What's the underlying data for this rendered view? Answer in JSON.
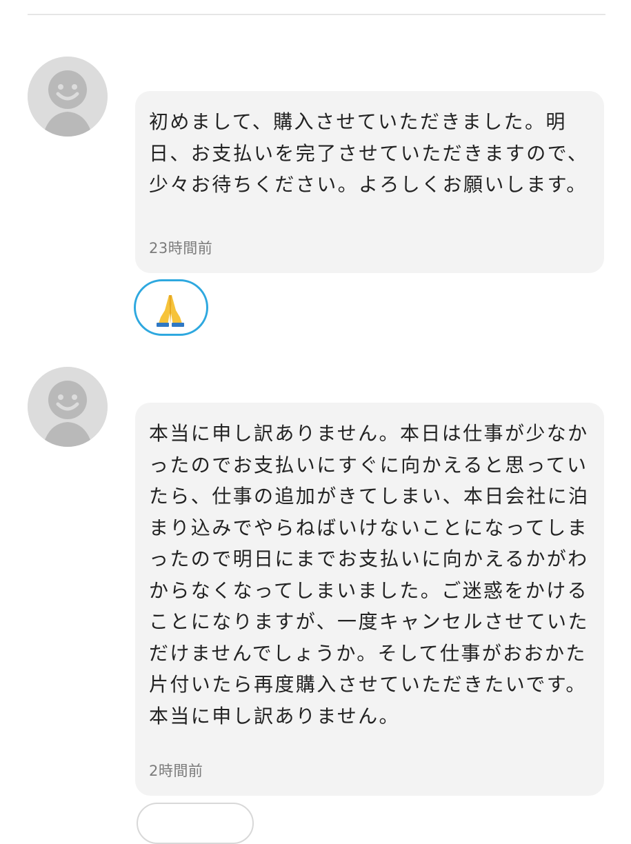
{
  "messages": [
    {
      "text": "初めまして、購入させていただきました。明日、お支払いを完了させていただきますので、少々お待ちください。よろしくお願いします。",
      "timestamp": "23時間前",
      "reaction_icon": "folded-hands-icon"
    },
    {
      "text": "本当に申し訳ありません。本日は仕事が少なかったのでお支払いにすぐに向かえると思っていたら、仕事の追加がきてしまい、本日会社に泊まり込みでやらねばいけないことになってしまったので明日にまでお支払いに向かえるかがわからなくなってしまいました。ご迷惑をかけることになりますが、一度キャンセルさせていただけませんでしょうか。そして仕事がおおかた片付いたら再度購入させていただきたいです。本当に申し訳ありません。",
      "timestamp": "2時間前"
    }
  ],
  "colors": {
    "bubble": "#f3f3f3",
    "avatar": "#dcdcdc",
    "reaction_border": "#2ea8df",
    "timestamp": "#7b7b7b"
  }
}
